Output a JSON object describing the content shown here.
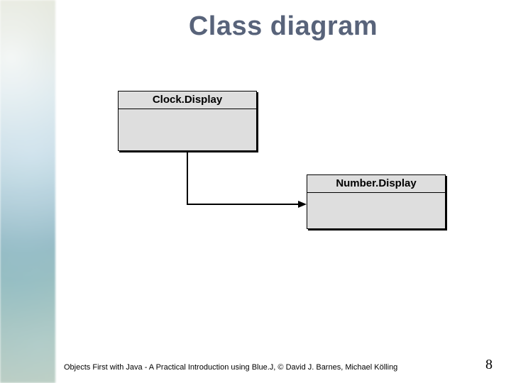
{
  "slide": {
    "title": "Class diagram"
  },
  "diagram": {
    "boxes": {
      "clock": {
        "name": "Clock.Display"
      },
      "number": {
        "name": "Number.Display"
      }
    },
    "arrow": {
      "from": "clock",
      "to": "number"
    }
  },
  "footer": {
    "text": "Objects First with Java - A Practical Introduction using Blue.J, © David J. Barnes, Michael Kölling",
    "page": "8"
  }
}
